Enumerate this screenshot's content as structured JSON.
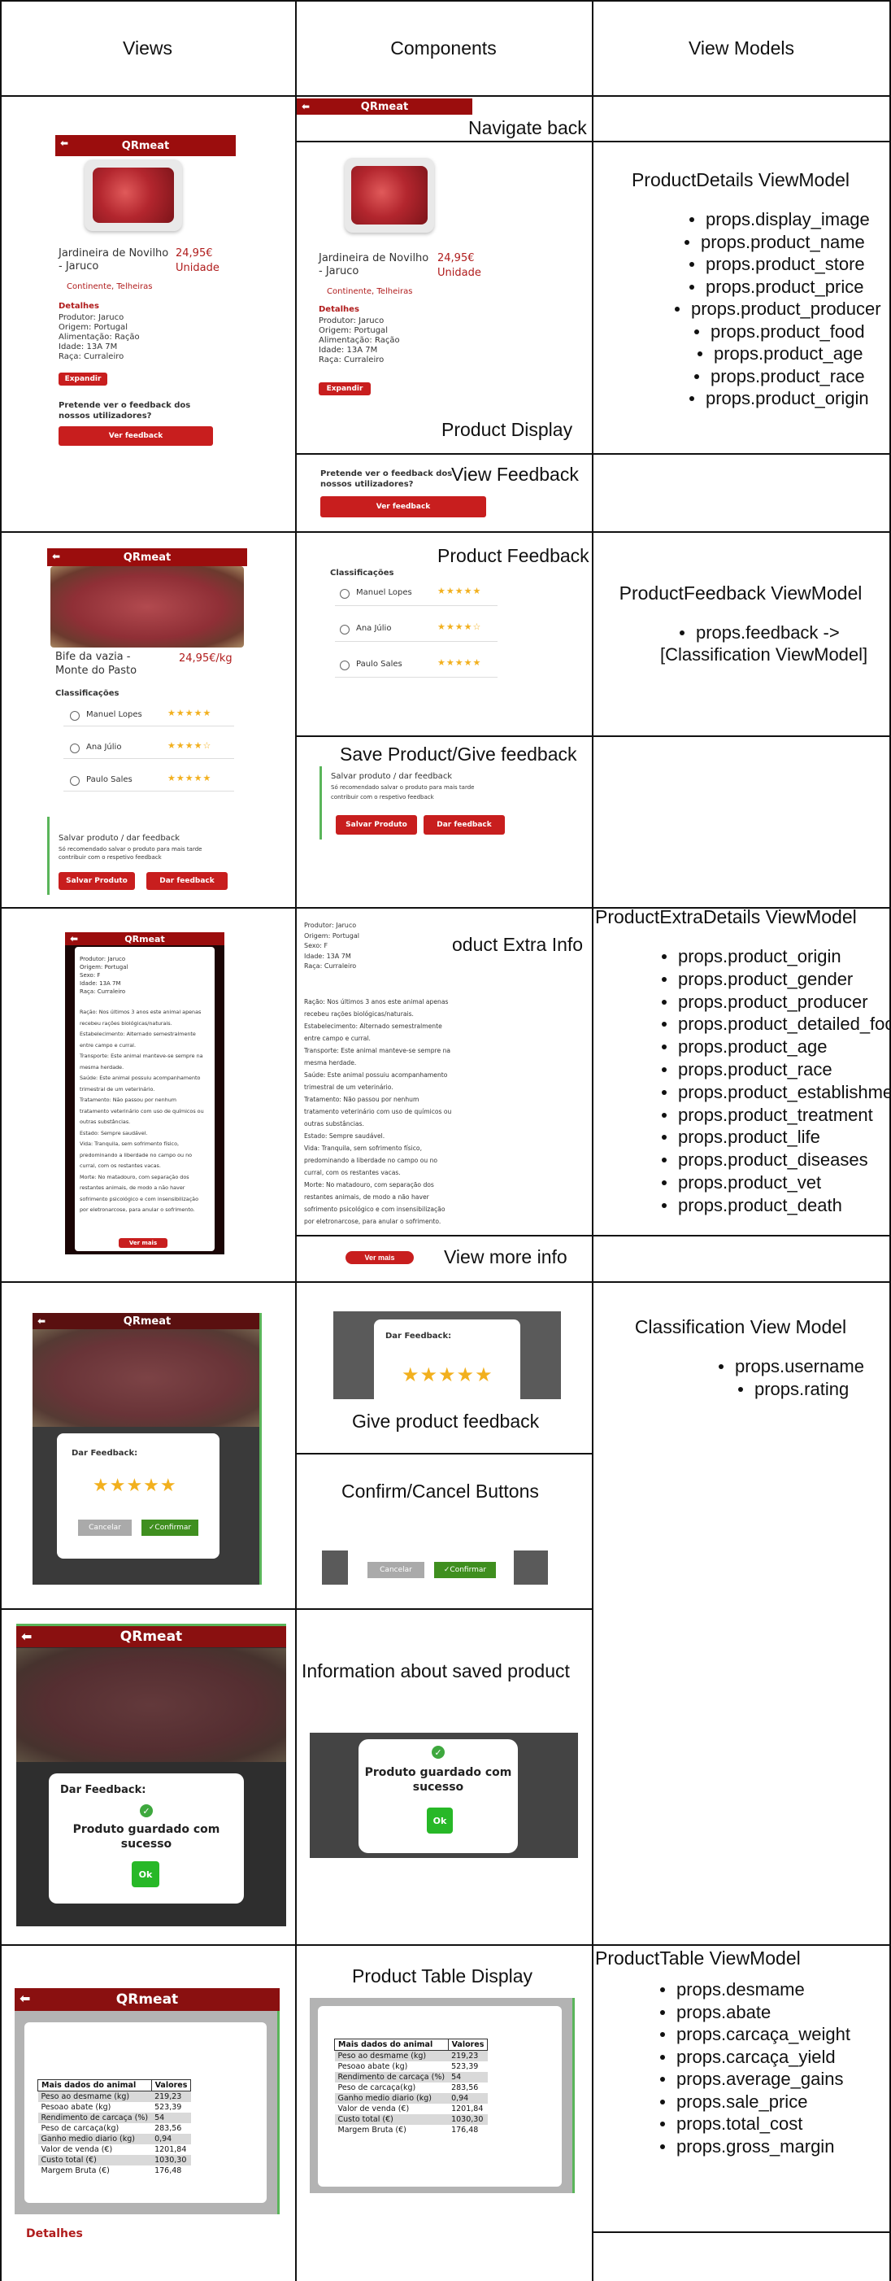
{
  "headers": {
    "views": "Views",
    "components": "Components",
    "view_models": "View Models"
  },
  "components": {
    "navigate_back": "Navigate back",
    "product_display": "Product Display",
    "view_feedback": "View Feedback",
    "product_feedback": "Product Feedback",
    "save_give_feedback": "Save Product/Give feedback",
    "product_extra_info": "Product Extra Info",
    "view_more_info": "View more info",
    "give_product_feedback": "Give product feedback",
    "confirm_cancel": "Confirm/Cancel Buttons",
    "saved_info": "Information about saved product",
    "product_table_display": "Product Table Display"
  },
  "view_models": {
    "product_details": {
      "title": "ProductDetails ViewModel",
      "props": [
        "props.display_image",
        "props.product_name",
        "props.product_store",
        "props.product_price",
        "props.product_producer",
        "props.product_food",
        "props.product_age",
        "props.product_race",
        "props.product_origin"
      ]
    },
    "product_feedback": {
      "title": "ProductFeedback ViewModel",
      "line1": "props.feedback ->",
      "line2": "[Classification ViewModel]"
    },
    "product_extra_details": {
      "title": "ProductExtraDetails ViewModel",
      "props": [
        "props.product_origin",
        "props.product_gender",
        "props.product_producer",
        "props.product_detailed_food",
        "props.product_age",
        "props.product_race",
        "props.product_establishment",
        "props.product_treatment",
        "props.product_life",
        "props.product_diseases",
        "props.product_vet",
        "props.product_death"
      ]
    },
    "classification": {
      "title": "Classification View Model",
      "props": [
        "props.username",
        "props.rating"
      ]
    },
    "product_table": {
      "title": "ProductTable ViewModel",
      "props": [
        "props.desmame",
        "props.abate",
        "props.carcaça_weight",
        "props.carcaça_yield",
        "props.average_gains",
        "props.sale_price",
        "props.total_cost",
        "props.gross_margin"
      ]
    }
  },
  "app": {
    "title": "QRmeat",
    "product_name_1": "Jardineira de Novilho",
    "product_name_2": "- Jaruco",
    "price": "24,95€",
    "unit": "Unidade",
    "store": "Continente, Telheiras",
    "details_title": "Detalhes",
    "details": [
      "Produtor: Jaruco",
      "Origem: Portugal",
      "Alimentação: Ração",
      "Idade: 13A 7M",
      "Raça: Curraleiro"
    ],
    "expand_button": "Expandir",
    "feedback_question_1": "Pretende ver o feedback dos",
    "feedback_question_2": "nossos utilizadores?",
    "see_feedback_button": "Ver feedback",
    "steak_name_1": "Bife da vazia -",
    "steak_name_2": "Monte do Pasto",
    "steak_price": "24,95€/kg",
    "classifications_title": "Classificações",
    "reviewers": [
      {
        "name": "Manuel Lopes",
        "stars": "★★★★★"
      },
      {
        "name": "Ana Júlio",
        "stars": "★★★★☆"
      },
      {
        "name": "Paulo Sales",
        "stars": "★★★★★"
      }
    ],
    "save_title": "Salvar produto / dar feedback",
    "save_desc_1": "Só recomendado salvar o produto para mais tarde",
    "save_desc_2": "contribuir com o respetivo feedback",
    "save_button": "Salvar Produto",
    "give_feedback_button": "Dar feedback",
    "extra_info": [
      "Produtor: Jaruco",
      "Origem: Portugal",
      "Sexo: F",
      "Idade: 13A 7M",
      "Raça: Curraleiro"
    ],
    "extra_long": [
      "Ração: Nos últimos 3 anos este animal apenas",
      "recebeu rações biológicas/naturais.",
      "Estabelecimento: Alternado semestralmente",
      "entre campo e curral.",
      "Transporte: Este animal manteve-se sempre na",
      "mesma herdade.",
      "Saúde: Este animal possuiu acompanhamento",
      "trimestral de um veterinário.",
      "Tratamento: Não passou por nenhum",
      "tratamento veterinário com uso de químicos ou",
      "outras substâncias.",
      "Estado: Sempre saudável.",
      "Vida: Tranquila, sem sofrimento físico,",
      "predominando a liberdade no campo ou no",
      "curral, com os restantes vacas.",
      "Morte: No matadouro, com separação dos",
      "restantes animais, de modo a não haver",
      "sofrimento psicológico e com insensibilização",
      "por eletronarcose, para anular o sofrimento."
    ],
    "see_more_button": "Ver mais",
    "dialog_title": "Dar Feedback:",
    "rating_stars": "★★★★★",
    "cancel_button": "Cancelar",
    "confirm_button": "✓Confirmar",
    "saved_message_1": "Produto guardado com",
    "saved_message_2": "sucesso",
    "ok_button": "Ok",
    "table_headers": [
      "Mais dados do animal",
      "Valores"
    ],
    "table_rows": [
      [
        "Peso ao desmame (kg)",
        "219,23"
      ],
      [
        "Pesoao abate (kg)",
        "523,39"
      ],
      [
        "Rendimento de carcaça (%)",
        "54"
      ],
      [
        "Peso de carcaça(kg)",
        "283,56"
      ],
      [
        "Ganho medio diario (kg)",
        "0,94"
      ],
      [
        "Valor de venda (€)",
        "1201,84"
      ],
      [
        "Custo total (€)",
        "1030,30"
      ],
      [
        "Margem Bruta (€)",
        "176,48"
      ]
    ],
    "table_footer": "Detalhes"
  }
}
